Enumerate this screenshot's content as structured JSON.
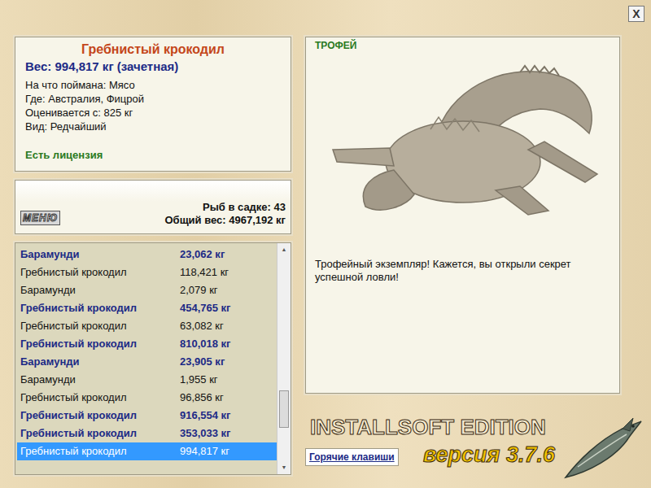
{
  "close_button": "X",
  "fish_card": {
    "name": "Гребнистый крокодил",
    "weight": "Вес: 994,817 кг (зачетная)",
    "details": [
      "На что поймана: Мясо",
      "Где: Австралия, Фицрой",
      "Оценивается с: 825 кг",
      "Вид: Редчайший"
    ],
    "license": "Есть лицензия"
  },
  "menu_button": "МЕНЮ",
  "keepnet": {
    "count": "Рыб в садке: 43",
    "total_weight": "Общий вес: 4967,192 кг"
  },
  "catch_list": {
    "scroll_level": 0.8,
    "up_arrow": "▲",
    "down_arrow": "▼",
    "rows": [
      {
        "name": "Барамунди",
        "weight": "23,062 кг",
        "trophy": true,
        "selected": false
      },
      {
        "name": "Гребнистый крокодил",
        "weight": "118,421 кг",
        "trophy": false,
        "selected": false
      },
      {
        "name": "Барамунди",
        "weight": "2,079 кг",
        "trophy": false,
        "selected": false
      },
      {
        "name": "Гребнистый крокодил",
        "weight": "454,765 кг",
        "trophy": true,
        "selected": false
      },
      {
        "name": "Гребнистый крокодил",
        "weight": "63,082 кг",
        "trophy": false,
        "selected": false
      },
      {
        "name": "Гребнистый крокодил",
        "weight": "810,018 кг",
        "trophy": true,
        "selected": false
      },
      {
        "name": "Барамунди",
        "weight": "23,905 кг",
        "trophy": true,
        "selected": false
      },
      {
        "name": "Барамунди",
        "weight": "1,955 кг",
        "trophy": false,
        "selected": false
      },
      {
        "name": "Гребнистый крокодил",
        "weight": "96,856 кг",
        "trophy": false,
        "selected": false
      },
      {
        "name": "Гребнистый крокодил",
        "weight": "916,554 кг",
        "trophy": true,
        "selected": false
      },
      {
        "name": "Гребнистый крокодил",
        "weight": "353,033 кг",
        "trophy": true,
        "selected": false
      },
      {
        "name": "Гребнистый крокодил",
        "weight": "994,817 кг",
        "trophy": false,
        "selected": true
      }
    ]
  },
  "trophy_panel": {
    "header": "ТРОФЕЙ",
    "message": "Трофейный экземпляр! Кажется, вы открыли секрет успешной ловли!"
  },
  "hotkeys_button": "Горячие клавиши",
  "brand": {
    "edition": "INSTALLSOFT EDITION",
    "version": "версия 3.7.6"
  }
}
